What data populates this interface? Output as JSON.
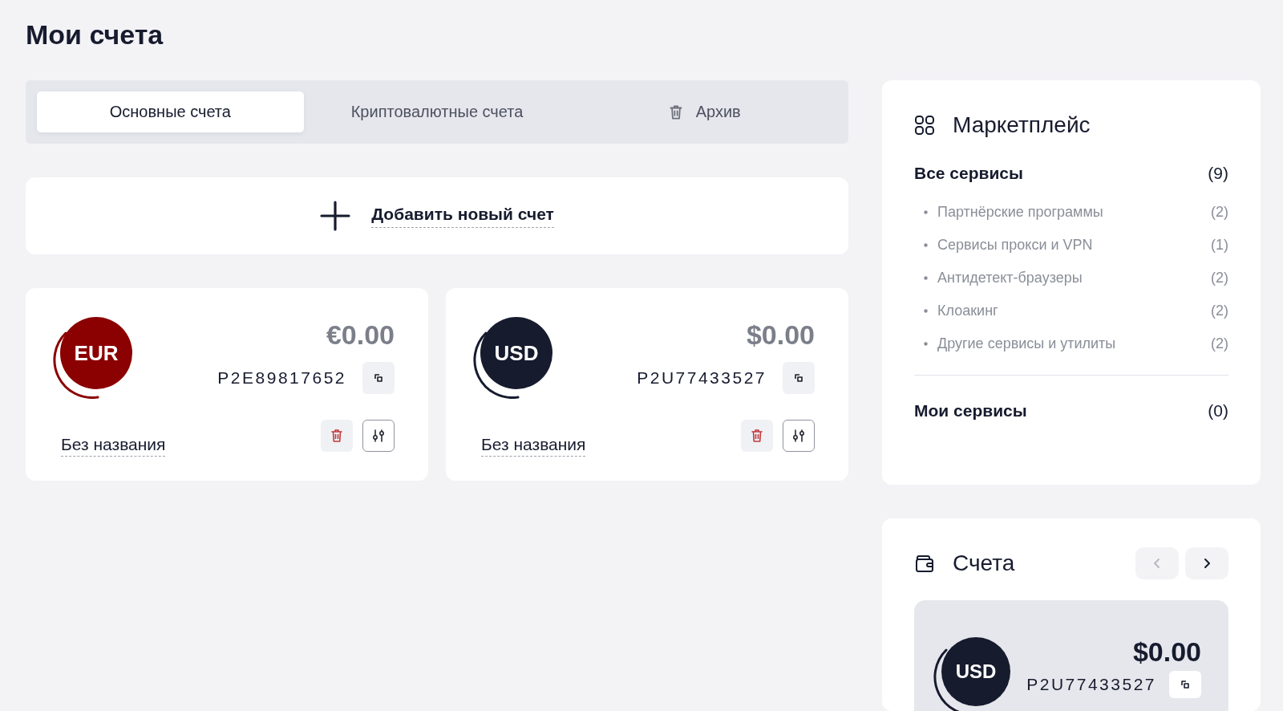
{
  "page": {
    "title": "Мои счета"
  },
  "tabs": [
    {
      "label": "Основные счета",
      "selected": true,
      "kind": "plain"
    },
    {
      "label": "Криптовалютные счета",
      "selected": false,
      "kind": "plain"
    },
    {
      "label": "Архив",
      "selected": false,
      "kind": "archive"
    }
  ],
  "add_account": {
    "label": "Добавить новый счет"
  },
  "accounts": [
    {
      "currency": "EUR",
      "color": "#8b0000",
      "amount": "€0.00",
      "dimmed": true,
      "number": "P2E89817652",
      "name": "Без названия"
    },
    {
      "currency": "USD",
      "color": "#161b2e",
      "amount": "$0.00",
      "dimmed": true,
      "number": "P2U77433527",
      "name": "Без названия"
    }
  ],
  "marketplace": {
    "title": "Маркетплейс",
    "groups": [
      {
        "label": "Все сервисы",
        "count": "(9)",
        "children": [
          {
            "label": "Партнёрские программы",
            "count": "(2)"
          },
          {
            "label": "Сервисы прокси и VPN",
            "count": "(1)"
          },
          {
            "label": "Антидетект-браузеры",
            "count": "(2)"
          },
          {
            "label": "Клоакинг",
            "count": "(2)"
          },
          {
            "label": "Другие сервисы и утилиты",
            "count": "(2)"
          }
        ]
      },
      {
        "label": "Мои сервисы",
        "count": "(0)"
      }
    ]
  },
  "accounts_widget": {
    "title": "Счета",
    "prev_disabled": true,
    "next_disabled": false,
    "card": {
      "currency": "USD",
      "color": "#161b2e",
      "amount": "$0.00",
      "number": "P2U77433527"
    }
  }
}
